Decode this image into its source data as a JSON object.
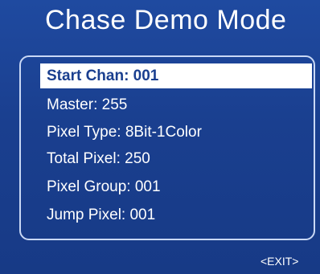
{
  "screen": {
    "title": "Chase Demo Mode"
  },
  "menu": {
    "items": [
      {
        "label": "Start Chan: 001",
        "selected": true
      },
      {
        "label": "Master: 255",
        "selected": false
      },
      {
        "label": "Pixel Type: 8Bit-1Color",
        "selected": false
      },
      {
        "label": "Total Pixel: 250",
        "selected": false
      },
      {
        "label": "Pixel Group: 001",
        "selected": false
      },
      {
        "label": "Jump Pixel: 001",
        "selected": false
      }
    ]
  },
  "footer": {
    "exit_label": "<EXIT>"
  },
  "colors": {
    "background": "#1a3f8f",
    "text": "#ffffff",
    "highlight": "#ffffff",
    "panel_border": "#c9d8f5"
  }
}
